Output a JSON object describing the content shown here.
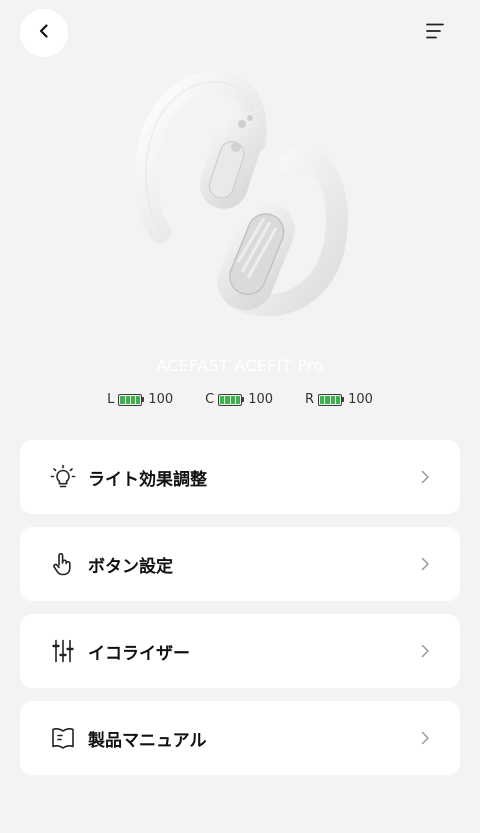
{
  "header": {
    "back_icon": "chevron-left-icon",
    "menu_icon": "menu-lines-icon"
  },
  "device": {
    "name": "ACEFAST ACEFIT Pro",
    "image": "earbuds-product-image"
  },
  "battery": [
    {
      "side": "L",
      "level": "100",
      "percent": 100
    },
    {
      "side": "C",
      "level": "100",
      "percent": 100
    },
    {
      "side": "R",
      "level": "100",
      "percent": 100
    }
  ],
  "menu": [
    {
      "label": "ライト効果調整",
      "icon": "lightbulb-icon"
    },
    {
      "label": "ボタン設定",
      "icon": "tap-hand-icon"
    },
    {
      "label": "イコライザー",
      "icon": "equalizer-sliders-icon"
    },
    {
      "label": "製品マニュアル",
      "icon": "manual-book-icon"
    }
  ],
  "colors": {
    "background": "#f3f3f3",
    "card": "#ffffff",
    "battery_fill": "#3bb34a"
  }
}
